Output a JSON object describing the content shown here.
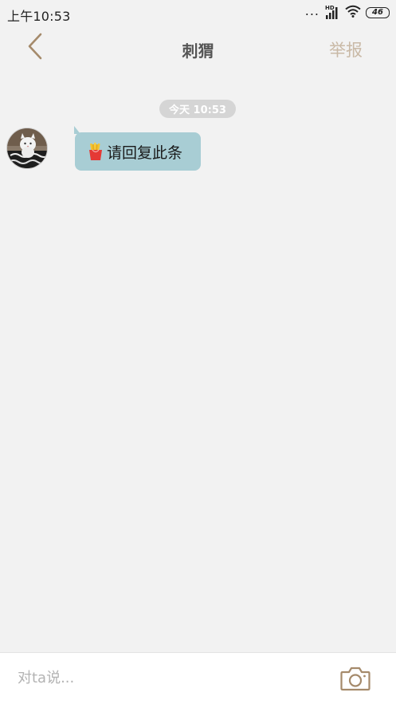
{
  "status_bar": {
    "time": "上午10:53",
    "dots": "...",
    "network_badge": "HD",
    "battery_level": "46",
    "icons": [
      "more-dots-icon",
      "signal-icon",
      "wifi-icon",
      "battery-icon"
    ]
  },
  "nav": {
    "back_icon": "chevron-left-icon",
    "title": "刺猬",
    "report_label": "举报"
  },
  "chat": {
    "timestamp": "今天 10:53",
    "messages": [
      {
        "sender": "other",
        "emoji_icon": "french-fries-icon",
        "text": "请回复此条"
      }
    ]
  },
  "input_bar": {
    "placeholder": "对ta说...",
    "value": "",
    "camera_icon": "camera-icon"
  },
  "colors": {
    "background": "#f2f2f2",
    "accent_brown": "#a58a6b",
    "report_text": "#c9b9a6",
    "bubble": "#a8cdd4",
    "timestamp_pill": "#d5d5d5"
  }
}
